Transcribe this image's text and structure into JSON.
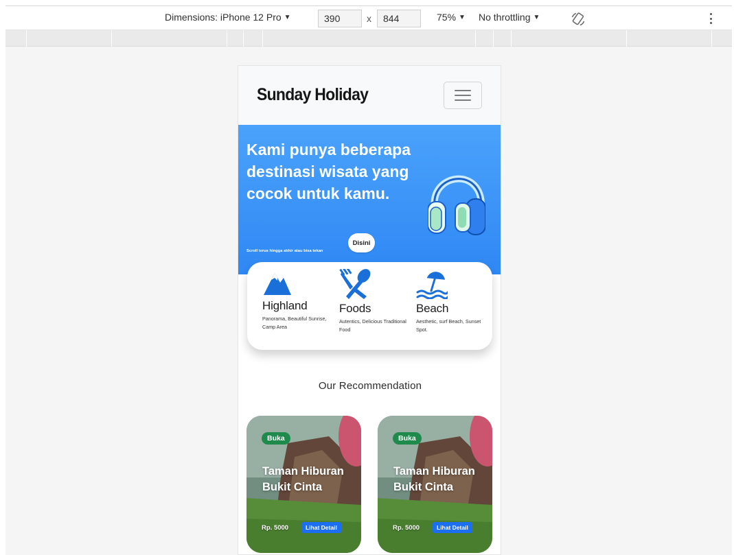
{
  "devtools": {
    "dimensions_label": "Dimensions: iPhone 12 Pro",
    "width": "390",
    "times": "x",
    "height": "844",
    "zoom": "75%",
    "throttling": "No throttling"
  },
  "navbar": {
    "brand": "Sunday Holiday"
  },
  "hero": {
    "title": "Kami punya beberapa destinasi wisata yang cocok untuk kamu.",
    "subtitle": "Scroll terus hingga akhir atau bisa tekan",
    "button_label": "Disini",
    "accent_color": "#3a93f8"
  },
  "categories": [
    {
      "name": "Highland",
      "desc": "Panorama, Beautiful Sunrise, Camp Area",
      "icon": "mountain-icon"
    },
    {
      "name": "Foods",
      "desc": "Autentics, Delicious Traditional Food",
      "icon": "fork-spoon-icon"
    },
    {
      "name": "Beach",
      "desc": "Aesthetic, surf Beach, Sunset Spot.",
      "icon": "beach-umbrella-icon"
    }
  ],
  "recommendation": {
    "title": "Our Recommendation",
    "cards": [
      {
        "status": "Buka",
        "name": "Taman Hiburan Bukit Cinta",
        "price": "Rp. 5000",
        "button_label": "Lihat Detail"
      },
      {
        "status": "Buka",
        "name": "Taman Hiburan Bukit Cinta",
        "price": "Rp. 5000",
        "button_label": "Lihat Detail"
      }
    ]
  },
  "colors": {
    "badge_green": "#1e8a4c",
    "button_blue": "#1d6ff2",
    "icon_blue": "#1a6fd8"
  }
}
